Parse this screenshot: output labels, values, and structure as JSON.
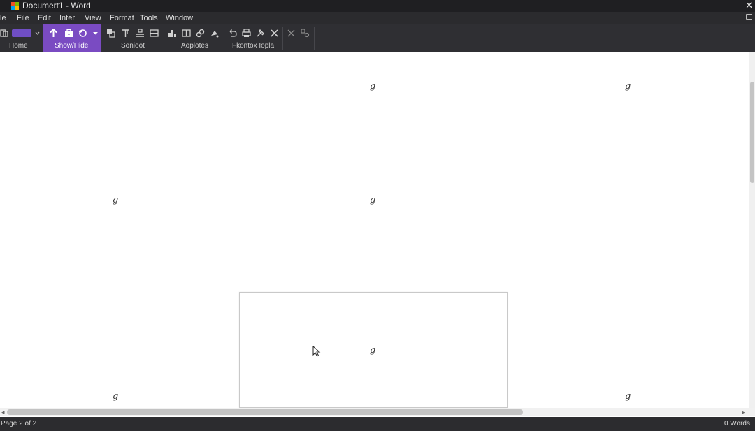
{
  "window": {
    "title": "Documert1 - Word"
  },
  "menubar": {
    "items": [
      "le",
      "File",
      "Edit",
      "Inter",
      "View",
      "Format",
      "Tools",
      "Window"
    ]
  },
  "ribbon": {
    "groups": [
      "Home",
      "Show/Hide",
      "Sonioot",
      "Aoplotes",
      "Fkontox Iopla"
    ],
    "accent_color": "#7a4bc2"
  },
  "document": {
    "glyph": "g"
  },
  "status": {
    "page": "Page 2 of 2",
    "words": "0 Words"
  }
}
